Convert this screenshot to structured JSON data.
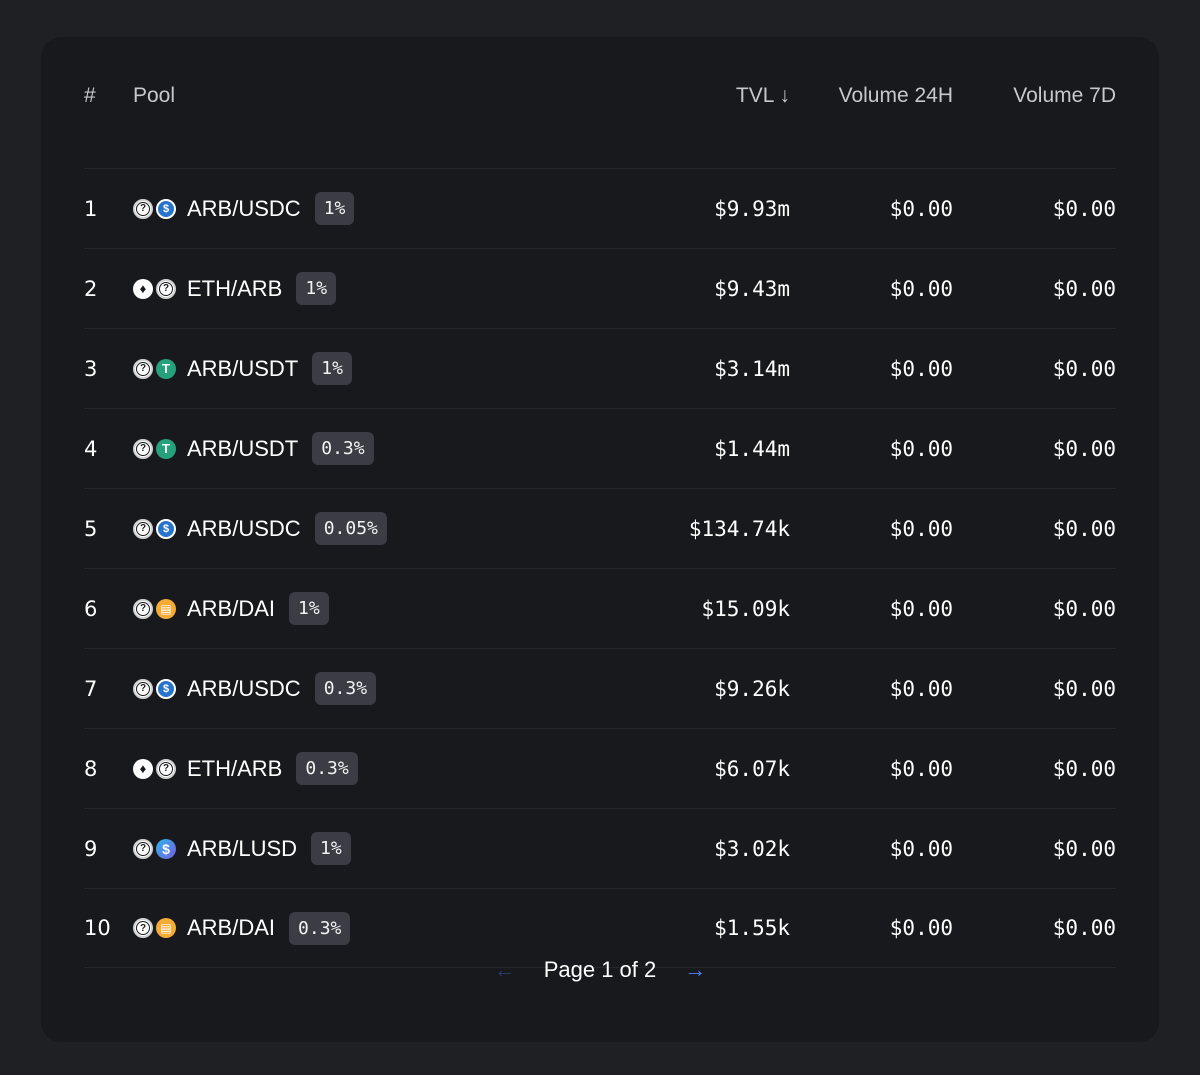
{
  "header": {
    "num": "#",
    "pool": "Pool",
    "tvl": "TVL ↓",
    "volume_24h": "Volume 24H",
    "volume_7d": "Volume 7D"
  },
  "rows": [
    {
      "num": "1",
      "pool": "ARB/USDC",
      "fee": "1%",
      "tvl": "$9.93m",
      "v24": "$0.00",
      "v7": "$0.00",
      "icons": [
        "unknown-token-icon",
        "usdc-icon"
      ]
    },
    {
      "num": "2",
      "pool": "ETH/ARB",
      "fee": "1%",
      "tvl": "$9.43m",
      "v24": "$0.00",
      "v7": "$0.00",
      "icons": [
        "eth-icon",
        "unknown-token-icon"
      ]
    },
    {
      "num": "3",
      "pool": "ARB/USDT",
      "fee": "1%",
      "tvl": "$3.14m",
      "v24": "$0.00",
      "v7": "$0.00",
      "icons": [
        "unknown-token-icon",
        "usdt-icon"
      ]
    },
    {
      "num": "4",
      "pool": "ARB/USDT",
      "fee": "0.3%",
      "tvl": "$1.44m",
      "v24": "$0.00",
      "v7": "$0.00",
      "icons": [
        "unknown-token-icon",
        "usdt-icon"
      ]
    },
    {
      "num": "5",
      "pool": "ARB/USDC",
      "fee": "0.05%",
      "tvl": "$134.74k",
      "v24": "$0.00",
      "v7": "$0.00",
      "icons": [
        "unknown-token-icon",
        "usdc-icon"
      ]
    },
    {
      "num": "6",
      "pool": "ARB/DAI",
      "fee": "1%",
      "tvl": "$15.09k",
      "v24": "$0.00",
      "v7": "$0.00",
      "icons": [
        "unknown-token-icon",
        "dai-icon"
      ]
    },
    {
      "num": "7",
      "pool": "ARB/USDC",
      "fee": "0.3%",
      "tvl": "$9.26k",
      "v24": "$0.00",
      "v7": "$0.00",
      "icons": [
        "unknown-token-icon",
        "usdc-icon"
      ]
    },
    {
      "num": "8",
      "pool": "ETH/ARB",
      "fee": "0.3%",
      "tvl": "$6.07k",
      "v24": "$0.00",
      "v7": "$0.00",
      "icons": [
        "eth-icon",
        "unknown-token-icon"
      ]
    },
    {
      "num": "9",
      "pool": "ARB/LUSD",
      "fee": "1%",
      "tvl": "$3.02k",
      "v24": "$0.00",
      "v7": "$0.00",
      "icons": [
        "unknown-token-icon",
        "lusd-icon"
      ]
    },
    {
      "num": "10",
      "pool": "ARB/DAI",
      "fee": "0.3%",
      "tvl": "$1.55k",
      "v24": "$0.00",
      "v7": "$0.00",
      "icons": [
        "unknown-token-icon",
        "dai-icon"
      ]
    }
  ],
  "pagination": {
    "label": "Page 1 of 2",
    "prev_icon": "arrow-left-icon",
    "next_icon": "arrow-right-icon"
  },
  "colors": {
    "background": "#1f2024",
    "card": "#18191d",
    "badge": "#3b3c44",
    "accent": "#4c82fb",
    "usdc": "#2775ca",
    "usdt": "#26a17b",
    "dai": "#f5ac37"
  }
}
